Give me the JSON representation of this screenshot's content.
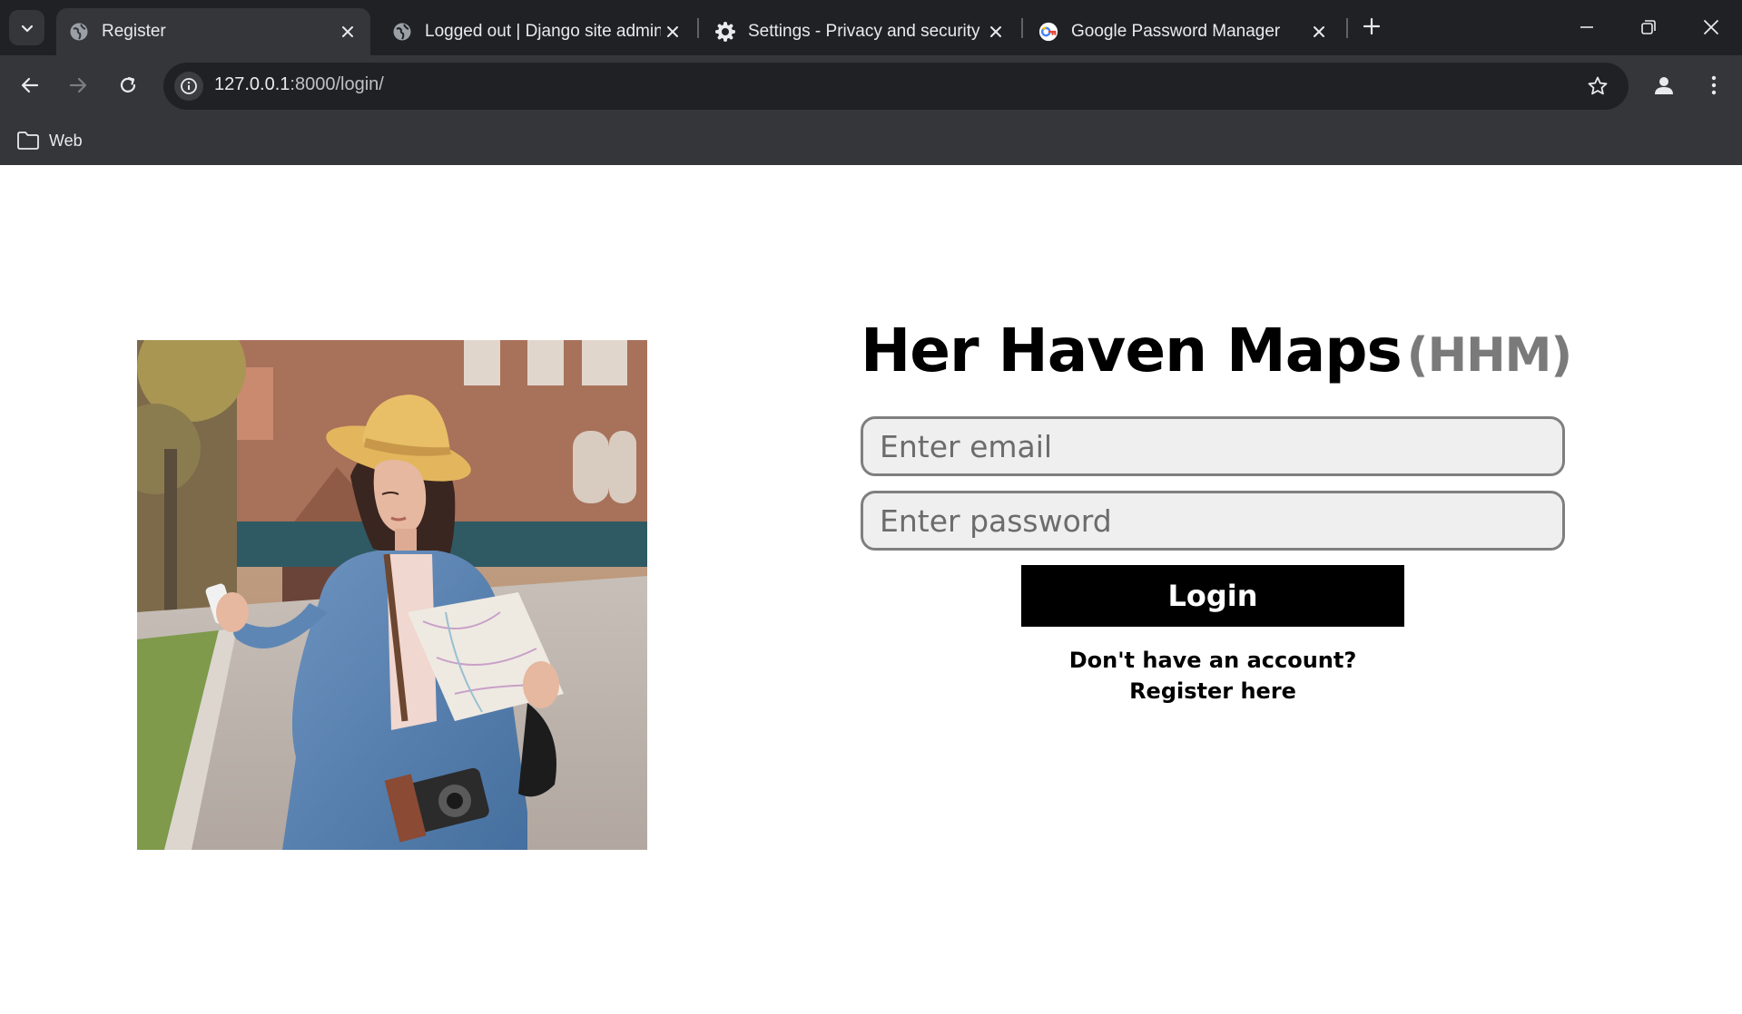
{
  "browser": {
    "tabs": [
      {
        "title": "Register",
        "favicon": "globe-icon",
        "active": true
      },
      {
        "title": "Logged out | Django site admin",
        "favicon": "globe-icon",
        "active": false
      },
      {
        "title": "Settings - Privacy and security",
        "favicon": "gear-icon",
        "active": false
      },
      {
        "title": "Google Password Manager",
        "favicon": "google-password-manager-icon",
        "active": false
      }
    ],
    "url": {
      "host": "127.0.0.1",
      "path": ":8000/login/"
    },
    "bookmarks": [
      {
        "label": "Web",
        "icon": "folder-icon"
      }
    ],
    "colors": {
      "tabstrip": "#202124",
      "toolbar": "#35363a",
      "text": "#e8eaed"
    }
  },
  "page": {
    "brand": {
      "name": "Her Haven Maps",
      "abbr": "(HHM)"
    },
    "email": {
      "placeholder": "Enter email",
      "value": ""
    },
    "password": {
      "placeholder": "Enter password",
      "value": ""
    },
    "login_label": "Login",
    "register_link": "Don't have an account? Register here",
    "hero_image": "woman-traveler-with-map-and-phone",
    "colors": {
      "accent": "#000000",
      "abbr": "#7a7a7a",
      "field_bg": "#efefef",
      "field_border": "#7f7f7f"
    }
  }
}
